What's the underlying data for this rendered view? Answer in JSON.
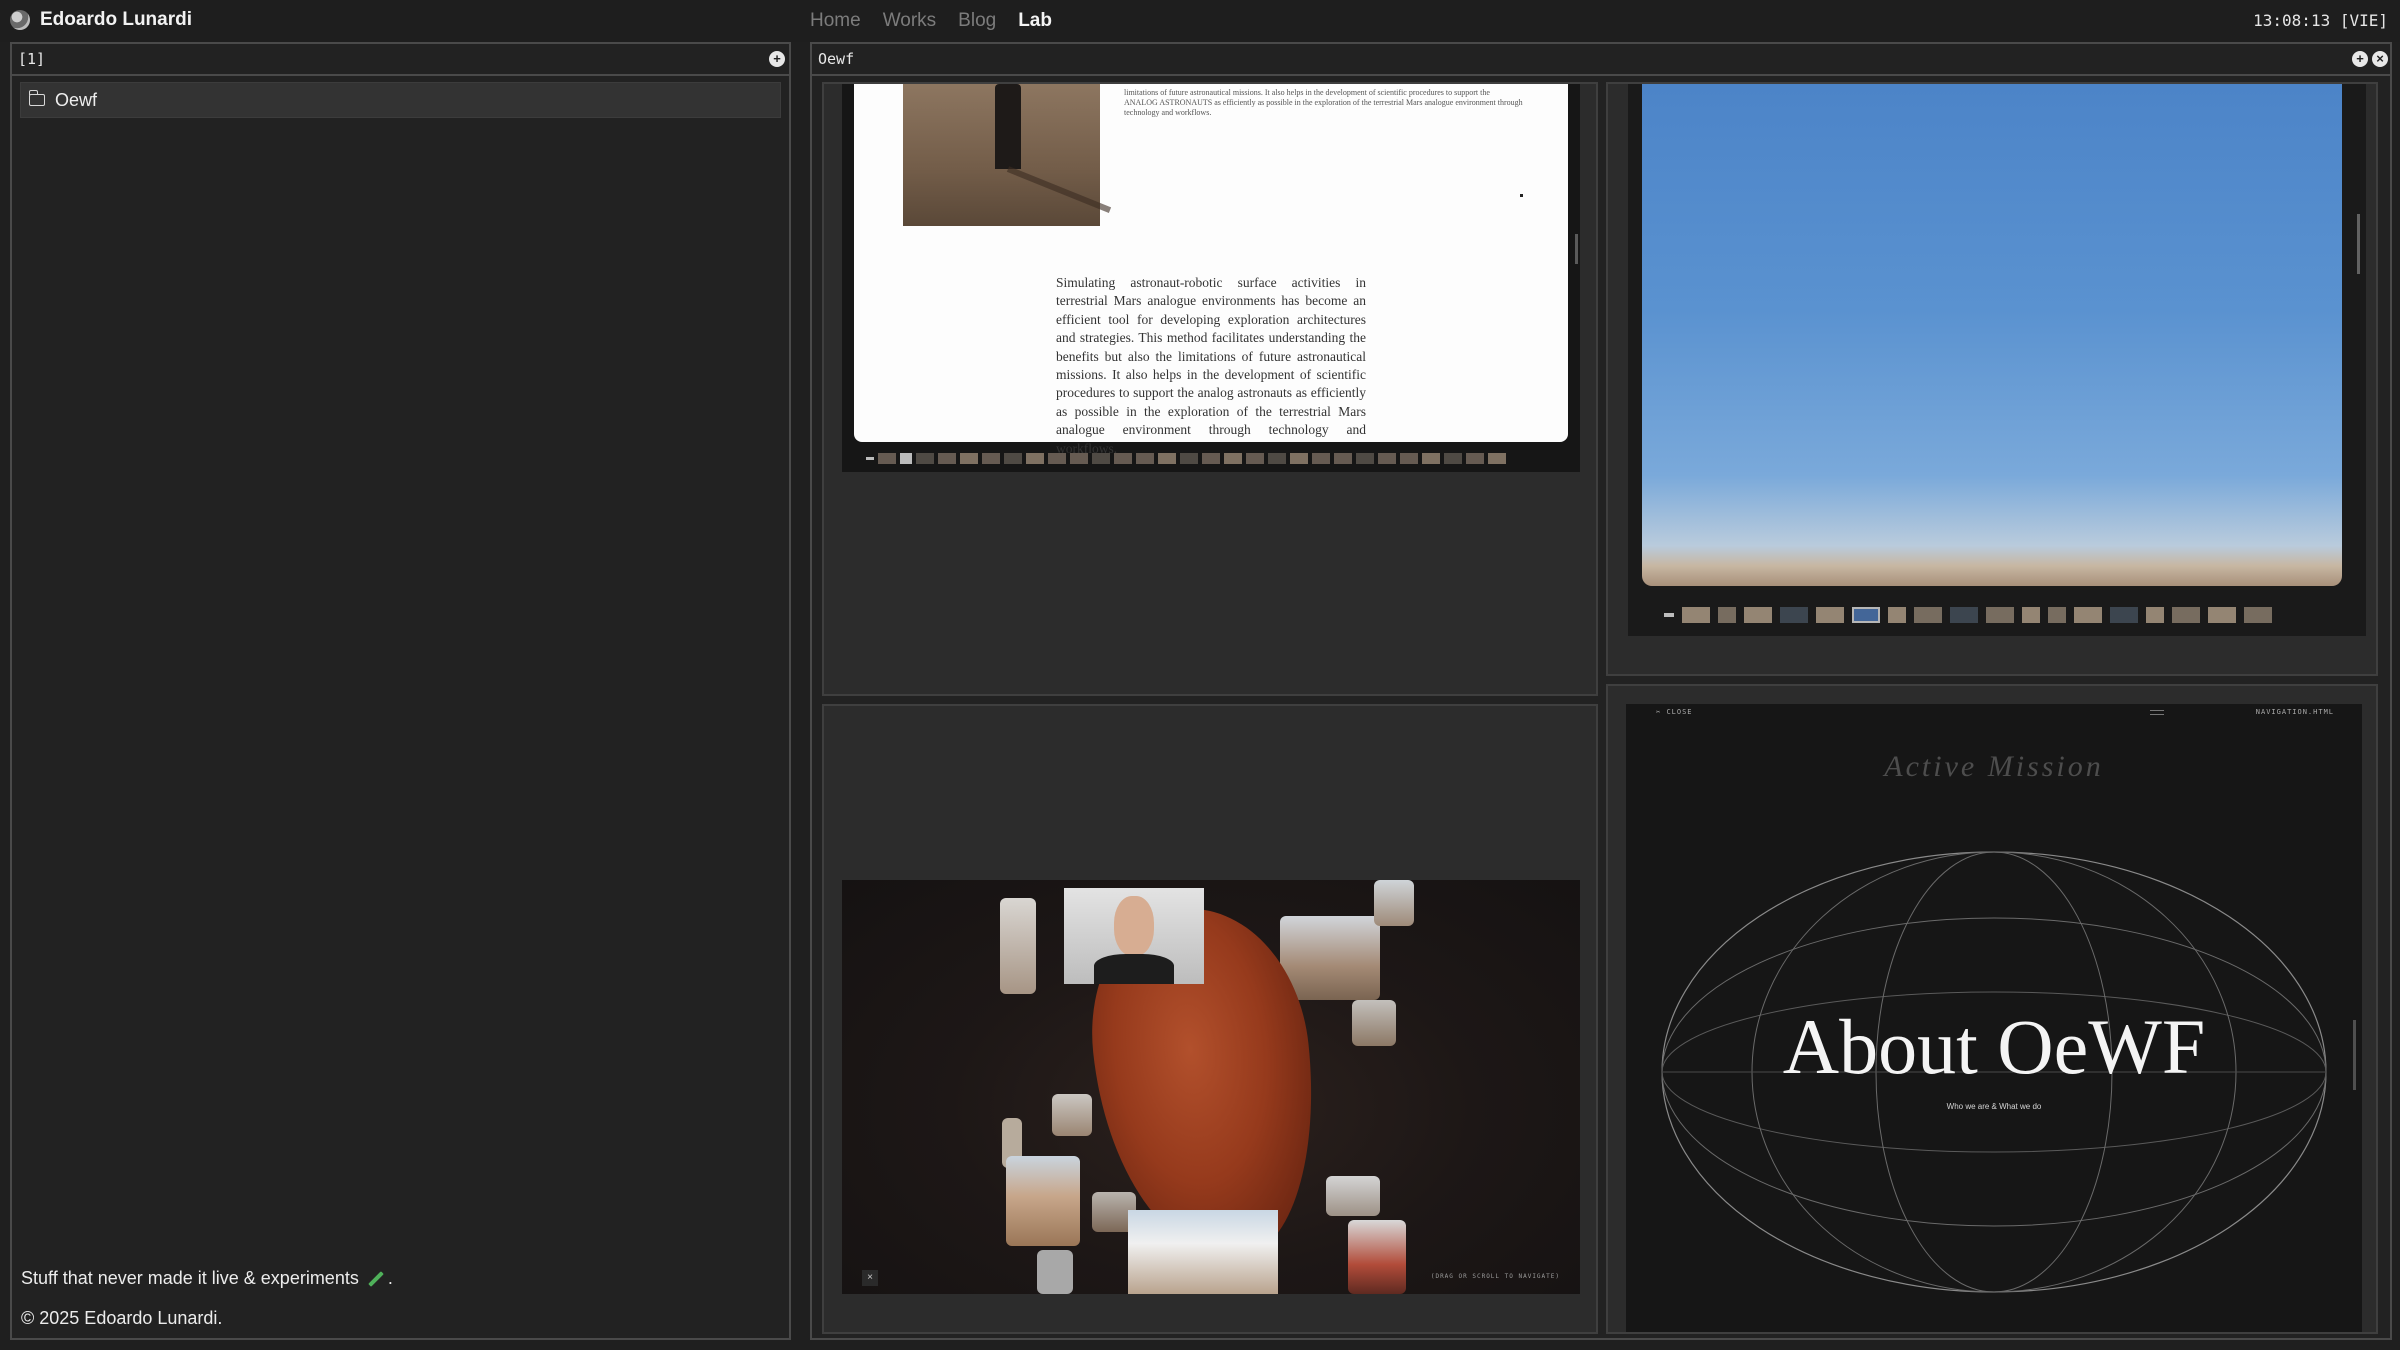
{
  "topbar": {
    "brand": "Edoardo Lunardi",
    "nav": [
      {
        "label": "Home",
        "active": false
      },
      {
        "label": "Works",
        "active": false
      },
      {
        "label": "Blog",
        "active": false
      },
      {
        "label": "Lab",
        "active": true
      }
    ],
    "clock": "13:08:13 [VIE]"
  },
  "left_panel": {
    "title": "[1]",
    "folder": "Oewf",
    "footer_line": "Stuff that never made it live & experiments",
    "footer_line_end": ".",
    "copyright": "© 2025 Edoardo Lunardi."
  },
  "right_panel": {
    "title": "Oewf"
  },
  "cells": {
    "doc": {
      "small_text": "limitations of future astronautical missions. It also helps in the development of scientific procedures to support the ANALOG ASTRONAUTS as efficiently as possible in the exploration of the terrestrial Mars analogue environment through technology and workflows.",
      "body": "Simulating astronaut-robotic surface activities in terrestrial Mars analogue environments has become an efficient tool for developing exploration architectures and strategies. This method facilitates understanding the benefits but also the limitations of future astronautical missions. It also helps in the development of scientific procedures to support the analog astronauts as efficiently as possible in the exploration of the terrestrial Mars analogue environment through technology and workflows."
    },
    "mars": {
      "close": "×",
      "hint": "(DRAG OR SCROLL TO NAVIGATE)"
    },
    "about": {
      "close": "CLOSE",
      "nav": "NAVIGATION.HTML",
      "mission": "Active Mission",
      "title": "About OeWF",
      "subtitle": "Who we are & What we do"
    }
  },
  "colors": {
    "background": "#1f1f1f",
    "panel_border": "#4a4a4a",
    "accent_pencil": "#4fb15a"
  }
}
